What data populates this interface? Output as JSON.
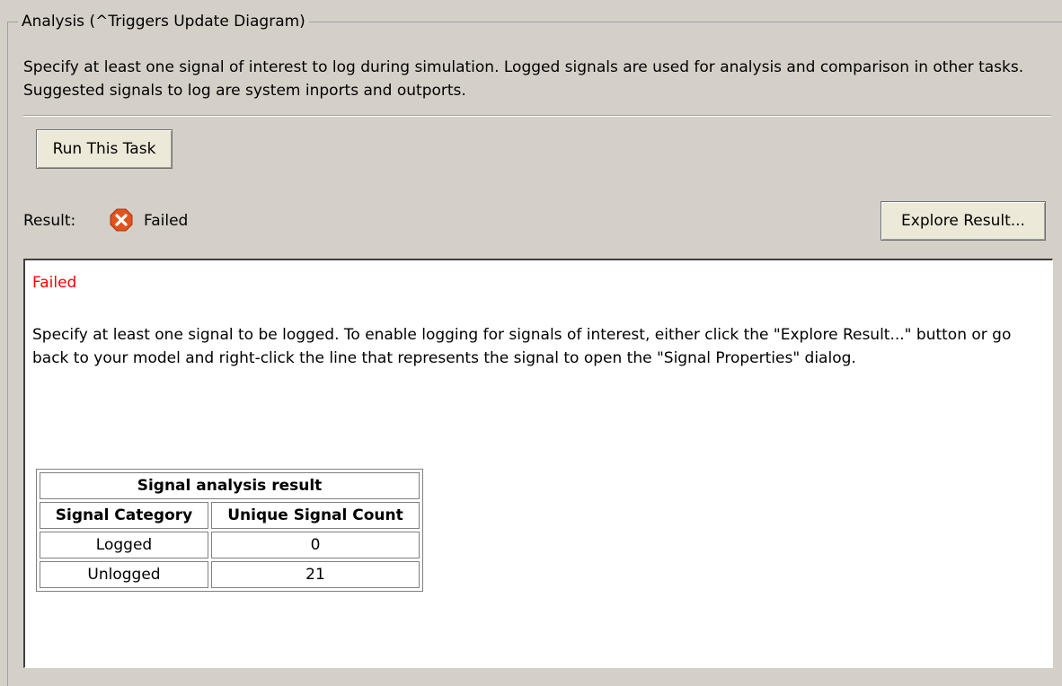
{
  "group": {
    "title": "Analysis (^Triggers Update Diagram)"
  },
  "description": "Specify at least one signal of interest to log during simulation. Logged signals are used for analysis and comparison in other tasks. Suggested signals to log are system inports and outports.",
  "buttons": {
    "run_task": "Run This Task",
    "explore_result": "Explore Result..."
  },
  "result": {
    "label": "Result:",
    "status": "Failed",
    "icon": "error-x-icon",
    "icon_color": "#e2531d"
  },
  "report": {
    "status": "Failed",
    "status_color": "#ff0000",
    "message": "Specify at least one signal to be logged. To enable logging for signals of interest, either click the \"Explore Result...\" button or go back to your model and right-click the line that represents the signal to open the \"Signal Properties\" dialog.",
    "table": {
      "caption": "Signal analysis result",
      "headers": [
        "Signal Category",
        "Unique Signal Count"
      ],
      "rows": [
        [
          "Logged",
          "0"
        ],
        [
          "Unlogged",
          "21"
        ]
      ]
    }
  }
}
